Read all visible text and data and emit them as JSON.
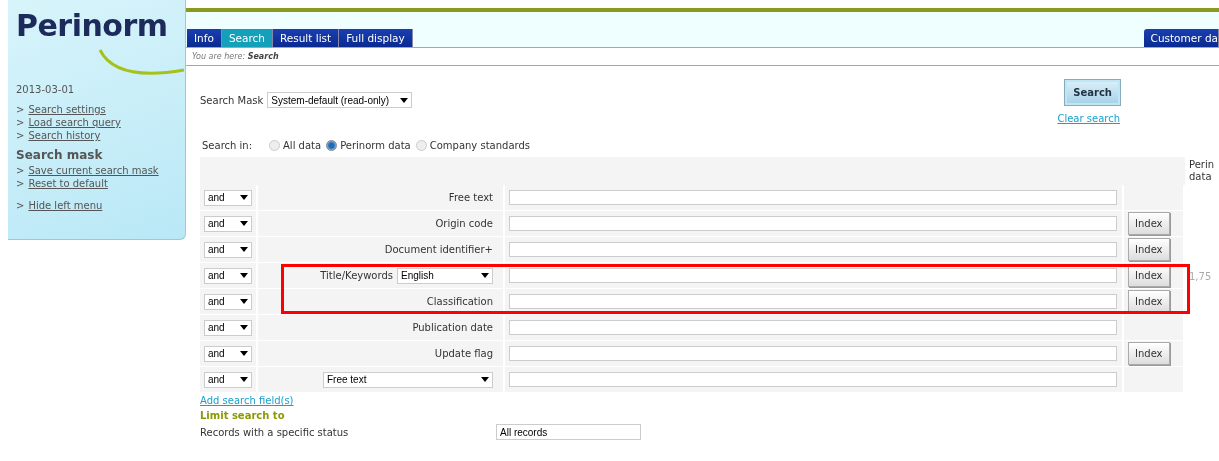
{
  "logo": "Perinorm",
  "sidebar": {
    "date": "2013-03-01",
    "links": [
      {
        "marker": ">",
        "label": "Search settings"
      },
      {
        "marker": ">",
        "label": "Load search query"
      },
      {
        "marker": ">",
        "label": "Search history"
      }
    ],
    "heading": "Search mask",
    "mask_links": [
      {
        "marker": ">",
        "label": "Save current search mask"
      },
      {
        "marker": ">",
        "label": "Reset to default"
      }
    ],
    "hide_link": {
      "marker": ">",
      "label": "Hide left menu"
    }
  },
  "tabs": [
    {
      "label": "Info",
      "selected": false
    },
    {
      "label": "Search",
      "selected": true
    },
    {
      "label": "Result list",
      "selected": false
    },
    {
      "label": "Full display",
      "selected": false
    }
  ],
  "right_tab": "Customer da",
  "breadcrumb": {
    "prefix": "You are here:",
    "current": "Search"
  },
  "search_mask": {
    "label": "Search Mask",
    "value": "System-default (read-only)"
  },
  "search_button": "Search",
  "clear_link": "Clear search",
  "search_in": {
    "label": "Search in:",
    "options": [
      {
        "label": "All data",
        "selected": false
      },
      {
        "label": "Perinorm data",
        "selected": true
      },
      {
        "label": "Company standards",
        "selected": false
      }
    ]
  },
  "count_heading": "Perin data",
  "rows": [
    {
      "kind": "label",
      "operator": "and",
      "label": "Free text",
      "index_button": null,
      "count": null,
      "highlighted": false
    },
    {
      "kind": "label",
      "operator": "and",
      "label": "Origin code",
      "index_button": "Index",
      "count": null,
      "highlighted": false
    },
    {
      "kind": "label",
      "operator": "and",
      "label": "Document identifier+",
      "index_button": "Index",
      "count": null,
      "highlighted": false
    },
    {
      "kind": "language",
      "operator": "and",
      "label": "Title/Keywords",
      "language": "English",
      "index_button": "Index",
      "count": "1,75",
      "highlighted": true
    },
    {
      "kind": "label",
      "operator": "and",
      "label": "Classification",
      "index_button": "Index",
      "count": null,
      "highlighted": true
    },
    {
      "kind": "label",
      "operator": "and",
      "label": "Publication date",
      "index_button": null,
      "count": null,
      "highlighted": false
    },
    {
      "kind": "label",
      "operator": "and",
      "label": "Update flag",
      "index_button": "Index",
      "count": null,
      "highlighted": false
    },
    {
      "kind": "field_select",
      "operator": "and",
      "field": "Free text",
      "index_button": null,
      "count": null,
      "highlighted": false
    }
  ],
  "add_link": "Add search field(s)",
  "limit_heading": "Limit search to",
  "status_row": {
    "label": "Records with a specific status",
    "value": "All records"
  }
}
